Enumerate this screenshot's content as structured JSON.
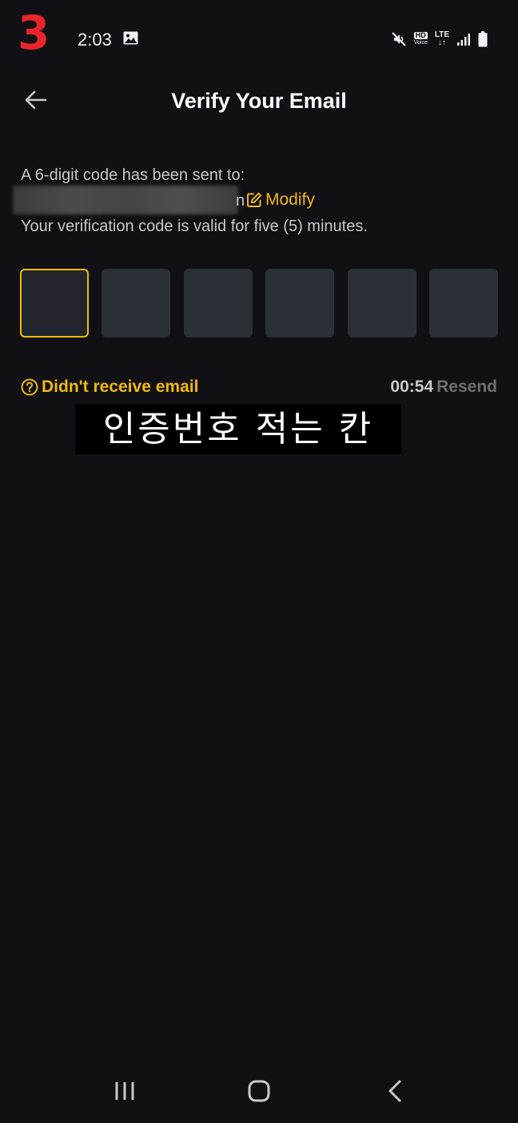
{
  "status_bar": {
    "overlay_number": "3",
    "time": "2:03",
    "hd_label": "HD",
    "voice_label": "Voice",
    "network_label": "LTE",
    "icons": [
      "gallery-icon",
      "mute-icon",
      "signal-icon",
      "battery-icon"
    ]
  },
  "header": {
    "title": "Verify Your Email",
    "back_icon": "arrow-left-icon"
  },
  "info": {
    "sent_to_text": "A 6-digit code has been sent to:",
    "email_visible_tail": "n",
    "modify_label": "Modify",
    "valid_text": "Your verification code is valid for five (5) minutes."
  },
  "code_input": {
    "digits": [
      "",
      "",
      "",
      "",
      "",
      ""
    ],
    "active_index": 0
  },
  "footer": {
    "help_label": "Didn't receive email",
    "countdown": "00:54",
    "resend_label": "Resend"
  },
  "annotation": {
    "caption": "인증번호 적는 칸"
  },
  "colors": {
    "background": "#111115",
    "accent": "#f0b90b",
    "box": "#2b2f36",
    "text_secondary": "#c7c9cc",
    "overlay_number": "#e8262a"
  }
}
